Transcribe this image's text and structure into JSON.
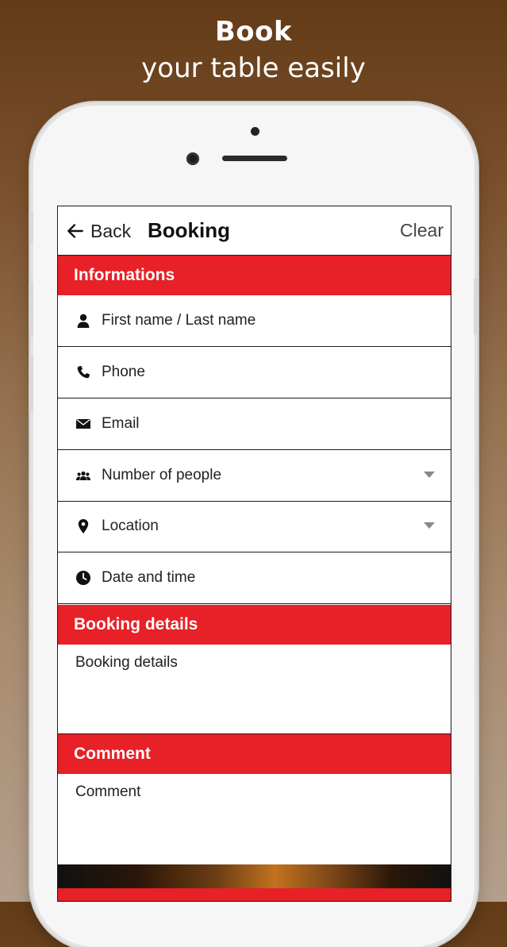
{
  "promo": {
    "title": "Book",
    "subtitle": "your table easily"
  },
  "nav": {
    "back_label": "Back",
    "title": "Booking",
    "clear_label": "Clear"
  },
  "sections": {
    "informations": "Informations",
    "booking_details": "Booking details",
    "comment": "Comment"
  },
  "fields": {
    "name": {
      "placeholder": "First name / Last name",
      "icon": "person-icon"
    },
    "phone": {
      "placeholder": "Phone",
      "icon": "phone-icon"
    },
    "email": {
      "placeholder": "Email",
      "icon": "envelope-icon"
    },
    "people": {
      "placeholder": "Number of people",
      "icon": "group-icon"
    },
    "location": {
      "placeholder": "Location",
      "icon": "location-pin-icon"
    },
    "datetime": {
      "placeholder": "Date and time",
      "icon": "clock-icon"
    },
    "booking_details": {
      "placeholder": "Booking details"
    },
    "comment": {
      "placeholder": "Comment"
    }
  },
  "colors": {
    "accent": "#e82027",
    "background_top": "#633b17",
    "background_bottom": "#b49f8c"
  }
}
